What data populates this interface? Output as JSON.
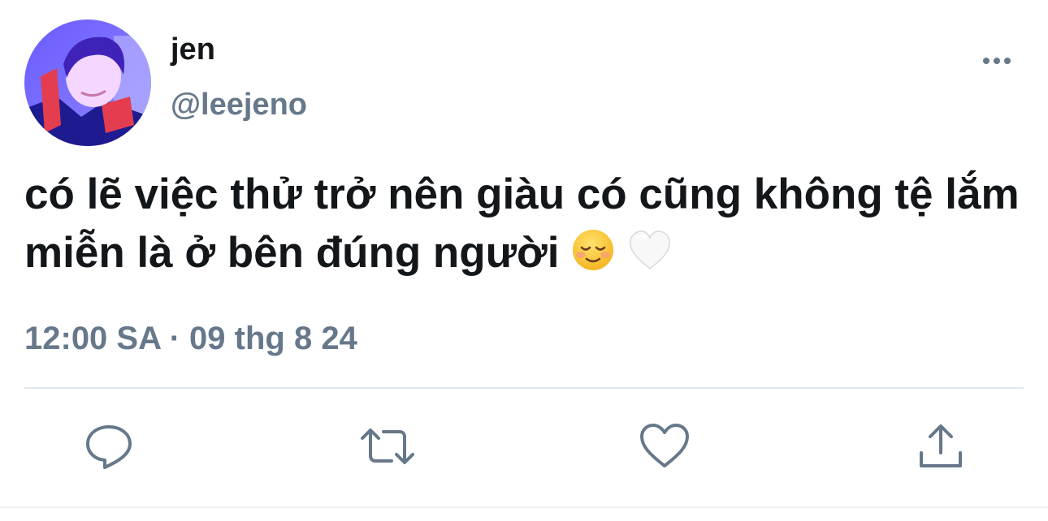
{
  "tweet": {
    "display_name": "jen",
    "handle": "@leejeno",
    "text": "có lẽ việc thử trở nên giàu có cũng không tệ lắm miễn là ở bên đúng người",
    "emojis": [
      "relieved-face-emoji",
      "white-heart-emoji"
    ],
    "timestamp": "12:00 SA · 09 thg 8 24"
  },
  "actions": [
    {
      "name": "reply",
      "icon": "comment-icon"
    },
    {
      "name": "retweet",
      "icon": "retweet-icon"
    },
    {
      "name": "like",
      "icon": "heart-icon"
    },
    {
      "name": "share",
      "icon": "share-icon"
    }
  ],
  "colors": {
    "text_primary": "#14171a",
    "text_secondary": "#66788a",
    "icon": "#66788a",
    "divider": "#e1e8ed"
  }
}
